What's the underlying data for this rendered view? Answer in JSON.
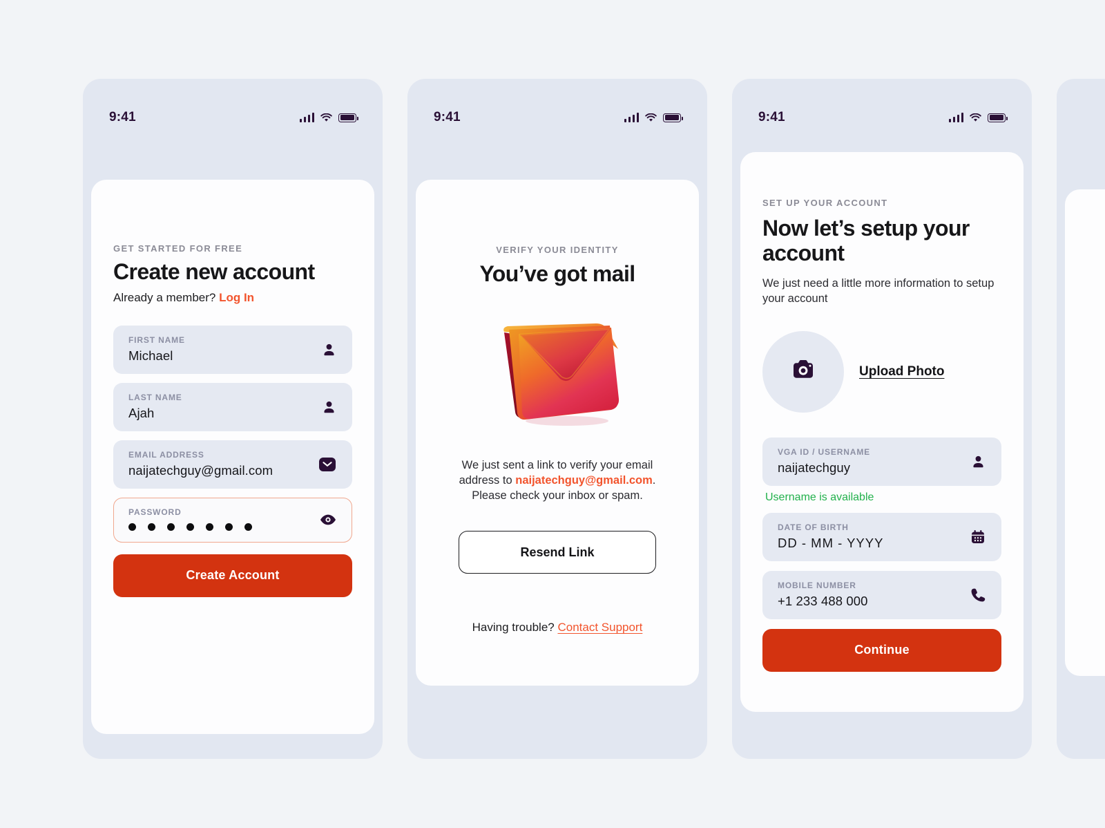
{
  "theme": {
    "page_bg": "#f2f4f7",
    "phone_bg": "#e2e7f1",
    "card_bg": "#fdfdfe",
    "field_bg": "#e5e9f2",
    "primary_red": "#d33310",
    "accent_coral": "#f2542d",
    "icon_dark": "#2a1036",
    "success_green": "#22b14c",
    "focus_border": "#f0a78e"
  },
  "status_bar": {
    "time": "9:41",
    "icons": [
      "cellular-signal-icon",
      "wifi-icon",
      "battery-icon"
    ]
  },
  "screens": [
    {
      "id": "create-account",
      "eyebrow": "GET STARTED FOR FREE",
      "title": "Create new account",
      "already_member_text": "Already a member? ",
      "login_link": "Log In",
      "fields": [
        {
          "label": "FIRST NAME",
          "value": "Michael",
          "icon": "person-icon",
          "state": "filled"
        },
        {
          "label": "LAST NAME",
          "value": "Ajah",
          "icon": "person-icon",
          "state": "filled"
        },
        {
          "label": "EMAIL ADDRESS",
          "value": "naijatechguy@gmail.com",
          "icon": "envelope-icon",
          "state": "filled"
        },
        {
          "label": "PASSWORD",
          "value": "•••••••",
          "dots": 7,
          "icon": "eye-icon",
          "state": "focused"
        }
      ],
      "cta": "Create Account"
    },
    {
      "id": "verify-email",
      "eyebrow": "VERIFY YOUR IDENTITY",
      "title": "You’ve got mail",
      "illustration": "3d-envelope-illustration",
      "body_part_1": "We just sent a link to verify your email address to ",
      "body_email": "naijatechguy@gmail.com",
      "body_part_2": ". Please check your inbox or spam.",
      "resend_button": "Resend Link",
      "trouble_text": "Having trouble? ",
      "support_link": "Contact Support"
    },
    {
      "id": "setup-account",
      "eyebrow": "SET UP YOUR ACCOUNT",
      "title": "Now let’s setup your account",
      "description": "We just need a little more information to setup your account",
      "avatar_icon": "camera-icon",
      "upload_link": "Upload Photo",
      "fields": [
        {
          "label": "VGA ID / USERNAME",
          "value": "naijatechguy",
          "icon": "person-icon",
          "state": "filled"
        },
        {
          "label": "DATE OF BIRTH",
          "value": "DD - MM - YYYY",
          "icon": "calendar-icon",
          "state": "placeholder"
        },
        {
          "label": "MOBILE NUMBER",
          "value": "+1 233 488 000",
          "icon": "phone-icon",
          "state": "filled"
        }
      ],
      "helper_text": "Username is available",
      "cta": "Continue"
    },
    {
      "id": "next-screen-partial",
      "note": ""
    }
  ]
}
